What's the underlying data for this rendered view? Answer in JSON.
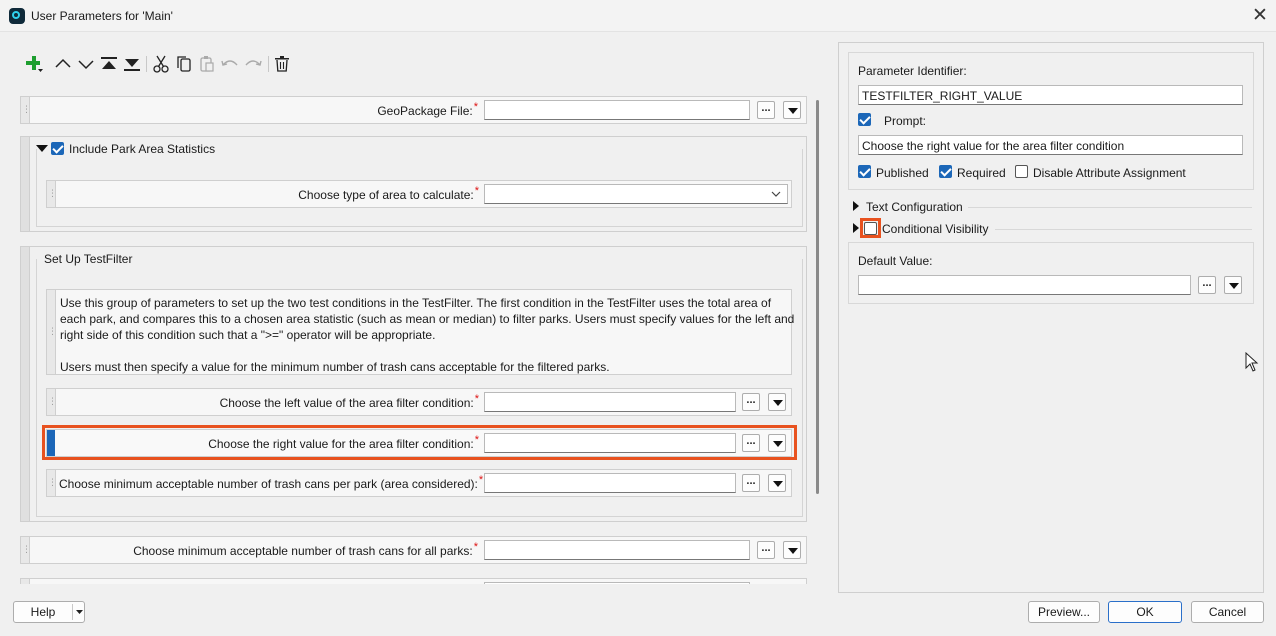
{
  "window": {
    "title": "User Parameters for 'Main'"
  },
  "left": {
    "geopackage": {
      "label": "GeoPackage File:"
    },
    "park_group": {
      "label": "Include Park Area Statistics",
      "area_type_label": "Choose type of area to calculate:"
    },
    "testfilter": {
      "title": "Set Up TestFilter",
      "desc_lines": [
        "Use this group of parameters to set up the two test conditions in the TestFilter. The first condition in the TestFilter uses the total area of",
        "each park, and compares this to a chosen area statistic (such as mean or median) to filter parks. Users must specify values for the left and",
        "right side of this condition such that a \">=\" operator will be appropriate.",
        "",
        "Users must then specify a value for the minimum number of trash cans acceptable for the filtered parks."
      ],
      "left_value_label": "Choose the left value of the area filter condition:",
      "right_value_label": "Choose the right value for the area filter condition:",
      "min_trash_label": "Choose minimum acceptable number of trash cans per park (area considered):"
    },
    "min_trash_all": {
      "label": "Choose minimum acceptable number of trash cans for all parks:"
    },
    "dots_label": "...",
    "required_mark": "*"
  },
  "right": {
    "identifier_label": "Parameter Identifier:",
    "identifier_value": "TESTFILTER_RIGHT_VALUE",
    "prompt_label": "Prompt:",
    "prompt_value": "Choose the right value for the area filter condition",
    "published_label": "Published",
    "required_label": "Required",
    "disable_attr_label": "Disable Attribute Assignment",
    "text_config_label": "Text Configuration",
    "cond_vis_label": "Conditional Visibility",
    "default_value_label": "Default Value:"
  },
  "footer": {
    "help": "Help",
    "preview": "Preview...",
    "ok": "OK",
    "cancel": "Cancel"
  },
  "colors": {
    "accent": "#1c67b8",
    "highlight": "#e8521f",
    "add_green": "#1e9e2f"
  }
}
